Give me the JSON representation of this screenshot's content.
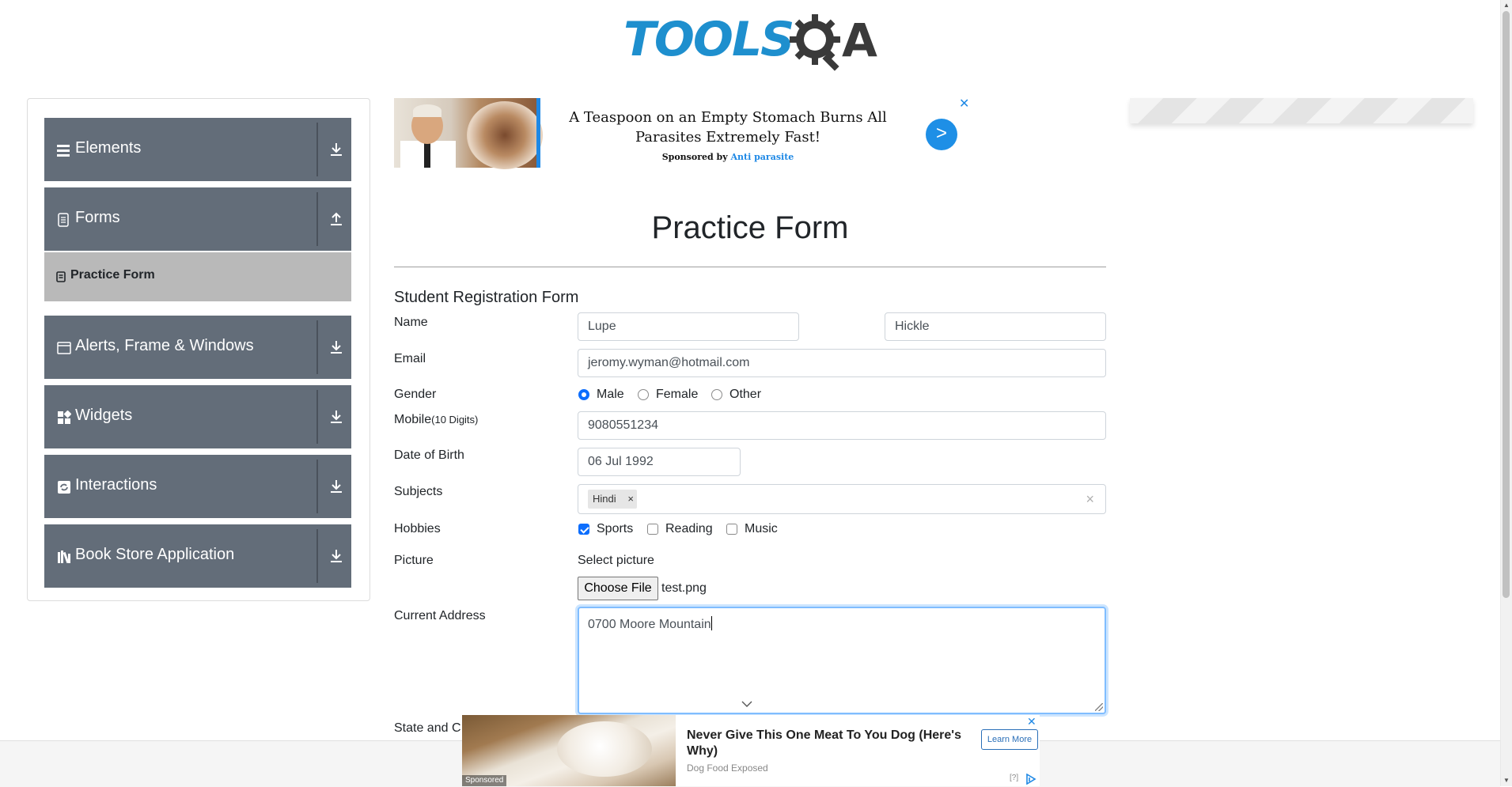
{
  "logo": {
    "text_tools": "TOOLS",
    "text_a": "A"
  },
  "sidebar": {
    "groups": [
      {
        "label": "Elements",
        "icon": "hamburger-icon",
        "arrow": "download-icon"
      },
      {
        "label": "Forms",
        "icon": "document-icon",
        "arrow": "upload-icon"
      },
      {
        "label": "Alerts, Frame & Windows",
        "icon": "window-icon",
        "arrow": "download-icon"
      },
      {
        "label": "Widgets",
        "icon": "grid-icon",
        "arrow": "download-icon"
      },
      {
        "label": "Interactions",
        "icon": "interaction-icon",
        "arrow": "download-icon"
      },
      {
        "label": "Book Store Application",
        "icon": "books-icon",
        "arrow": "download-icon"
      }
    ],
    "active_item": {
      "label": "Practice Form",
      "icon": "form-icon"
    }
  },
  "ad_top": {
    "headline": "A Teaspoon on an Empty Stomach Burns All Parasites Extremely Fast!",
    "sponsored_prefix": "Sponsored by",
    "sponsor": "Anti parasite",
    "go": ">",
    "close": "✕"
  },
  "page": {
    "title": "Practice Form"
  },
  "form": {
    "title": "Student Registration Form",
    "labels": {
      "name": "Name",
      "email": "Email",
      "gender": "Gender",
      "mobile": "Mobile",
      "mobile_hint": "(10 Digits)",
      "dob": "Date of Birth",
      "subjects": "Subjects",
      "hobbies": "Hobbies",
      "picture": "Picture",
      "address": "Current Address",
      "state_city": "State and C"
    },
    "first_name": "Lupe",
    "last_name": "Hickle",
    "email": "jeromy.wyman@hotmail.com",
    "gender_options": [
      "Male",
      "Female",
      "Other"
    ],
    "gender_selected": "Male",
    "mobile": "9080551234",
    "dob": "06 Jul 1992",
    "subjects": [
      "Hindi"
    ],
    "subject_remove": "×",
    "subjects_clear": "×",
    "hobby_options": [
      "Sports",
      "Reading",
      "Music"
    ],
    "hobbies_checked": [
      "Sports"
    ],
    "picture_prompt": "Select picture",
    "file_button": "Choose File",
    "file_name": "test.png",
    "address": "0700 Moore Mountain"
  },
  "ad_bottom": {
    "title": "Never Give This One Meat To You Dog (Here's Why)",
    "source": "Dog Food Exposed",
    "button": "Learn More",
    "sponsored": "Sponsored",
    "help": "[?]",
    "close": "✕"
  },
  "colors": {
    "sidebar_group": "#636d79",
    "active_item": "#b9b9b9",
    "logo_blue": "#1e8fce",
    "accent": "#0d6efd"
  }
}
